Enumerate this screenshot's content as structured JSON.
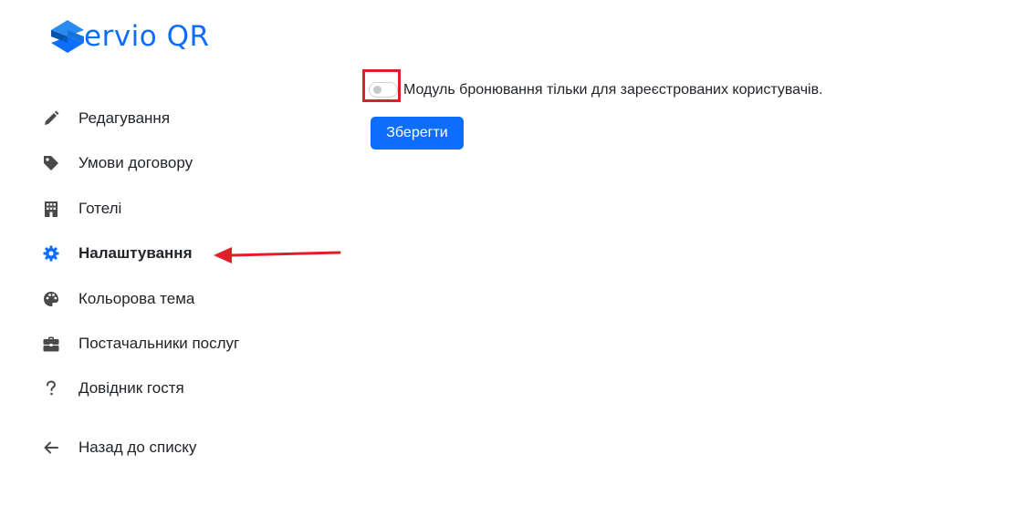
{
  "brand": {
    "name": "ervio QR",
    "accent_color": "#0d6efd"
  },
  "sidebar": {
    "items": [
      {
        "label": "Редагування",
        "icon": "pencil-icon"
      },
      {
        "label": "Умови договору",
        "icon": "tag-icon"
      },
      {
        "label": "Готелі",
        "icon": "building-icon"
      },
      {
        "label": "Налаштування",
        "icon": "gear-icon",
        "active": true
      },
      {
        "label": "Кольорова тема",
        "icon": "palette-icon"
      },
      {
        "label": "Постачальники послуг",
        "icon": "briefcase-icon"
      },
      {
        "label": "Довідник гостя",
        "icon": "question-icon"
      }
    ],
    "back": {
      "label": "Назад до списку",
      "icon": "arrow-left-icon"
    }
  },
  "settings": {
    "booking_toggle": {
      "label": "Модуль бронювання тільки для зареєстрованих користувачів.",
      "checked": false
    },
    "save_label": "Зберегти"
  },
  "annotation_color": "#e01f26"
}
